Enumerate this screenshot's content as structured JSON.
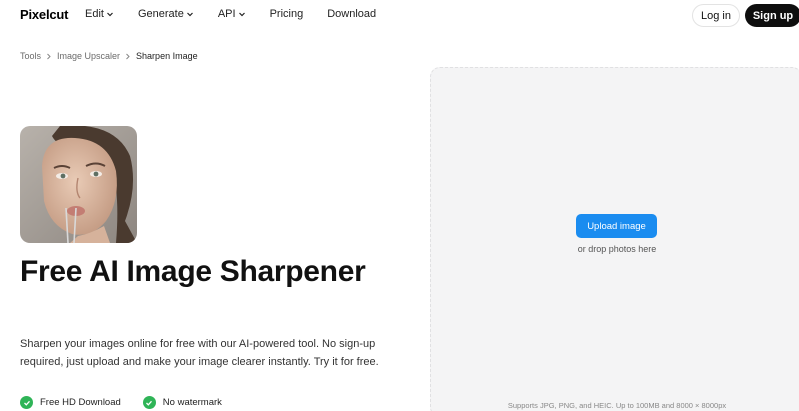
{
  "nav": {
    "logo": "Pixelcut",
    "items": [
      {
        "label": "Edit",
        "dropdown": true
      },
      {
        "label": "Generate",
        "dropdown": true
      },
      {
        "label": "API",
        "dropdown": true
      },
      {
        "label": "Pricing",
        "dropdown": false
      },
      {
        "label": "Download",
        "dropdown": false
      }
    ],
    "login": "Log in",
    "signup": "Sign up"
  },
  "breadcrumb": {
    "items": [
      "Tools",
      "Image Upscaler",
      "Sharpen Image"
    ]
  },
  "hero": {
    "title": "Free AI Image Sharpener",
    "description": "Sharpen your images online for free with our AI-powered tool. No sign-up required, just upload and make your image clearer instantly. Try it for free.",
    "badges": [
      "Free HD Download",
      "No watermark"
    ]
  },
  "upload": {
    "button": "Upload image",
    "drop_text": "or drop photos here",
    "support_text": "Supports JPG, PNG, and HEIC. Up to 100MB and 8000 × 8000px"
  },
  "colors": {
    "accent": "#1a8cf0",
    "check": "#2fb457",
    "signup_bg": "#0e0e0e",
    "panel_bg": "#f4f4f5"
  }
}
